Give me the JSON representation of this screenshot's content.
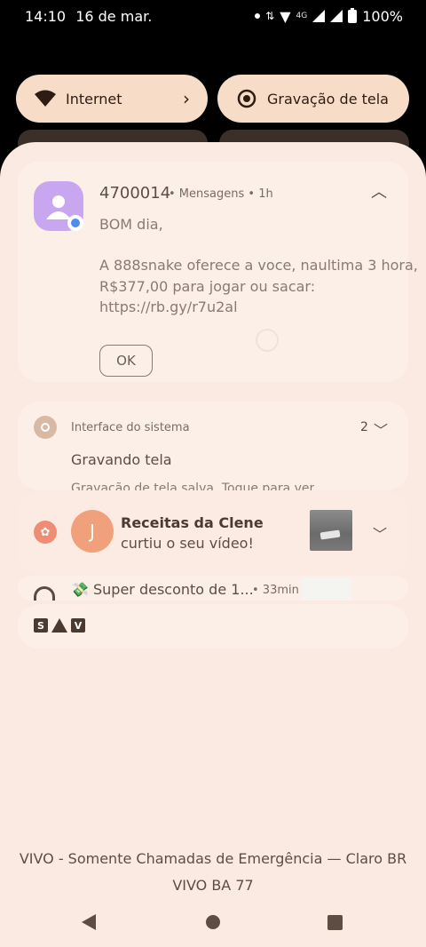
{
  "status_bar": {
    "time": "14:10",
    "date": "16 de mar.",
    "network_label": "4G",
    "battery": "100%"
  },
  "quick_tiles": {
    "internet_label": "Internet",
    "screen_record_label": "Gravação de tela"
  },
  "notifications": {
    "message": {
      "sender": "4700014",
      "meta": "• Mensagens • 1h",
      "lines": [
        "BOM dia,",
        "",
        "A 888snake oferece a voce, naultima 3 hora,",
        "R$377,00 para jogar ou sacar:",
        "https://rb.gy/r7u2al"
      ],
      "ok_label": "OK"
    },
    "system": {
      "app": "Interface do sistema",
      "count": "2",
      "title": "Gravando tela",
      "subtitle": "Gravação de tela salva. Toque para ver"
    },
    "recipes": {
      "avatar_letter": "J",
      "name": "Receitas da Clene",
      "text": " curtiu o seu vídeo!"
    },
    "deal": {
      "text": "💸 Super desconto de 1...",
      "time": "• 33min"
    },
    "strip_icons": [
      "S",
      "V"
    ]
  },
  "carrier": {
    "line1": "VIVO - Somente Chamadas de Emergência — Claro BR",
    "line2": "VIVO BA 77"
  },
  "colors": {
    "shade_bg": "#fbeae2",
    "tile_bg": "#f7dcc8",
    "app_icon": "#c9a7f0",
    "avatar": "#f0a07a"
  }
}
